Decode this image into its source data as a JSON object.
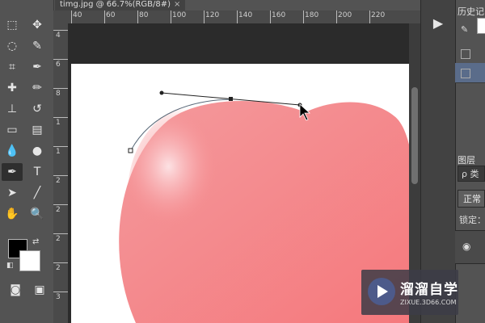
{
  "document_tab": {
    "title": "timg.jpg @ 66.7%(RGB/8#)",
    "close_symbol": "×"
  },
  "ruler": {
    "top_labels": [
      "40",
      "60",
      "80",
      "100",
      "120",
      "140",
      "160",
      "180",
      "200",
      "220"
    ],
    "left_labels": [
      "4",
      "6",
      "8",
      "1",
      "1",
      "2",
      "2",
      "2",
      "2",
      "3"
    ]
  },
  "tools": [
    {
      "name": "marquee-tool",
      "icon": "⬚"
    },
    {
      "name": "move-tool",
      "icon": "✥"
    },
    {
      "name": "lasso-tool",
      "icon": "◌"
    },
    {
      "name": "quick-select-tool",
      "icon": "✎"
    },
    {
      "name": "crop-tool",
      "icon": "⌗"
    },
    {
      "name": "eyedropper-tool",
      "icon": "✒"
    },
    {
      "name": "healing-brush-tool",
      "icon": "✚"
    },
    {
      "name": "brush-tool",
      "icon": "✏"
    },
    {
      "name": "clone-stamp-tool",
      "icon": "⊥"
    },
    {
      "name": "history-brush-tool",
      "icon": "↺"
    },
    {
      "name": "eraser-tool",
      "icon": "▭"
    },
    {
      "name": "gradient-tool",
      "icon": "▤"
    },
    {
      "name": "blur-tool",
      "icon": "💧"
    },
    {
      "name": "dodge-tool",
      "icon": "●"
    },
    {
      "name": "pen-tool",
      "icon": "✒"
    },
    {
      "name": "type-tool",
      "icon": "T"
    },
    {
      "name": "path-select-tool",
      "icon": "➤"
    },
    {
      "name": "line-tool",
      "icon": "╱"
    },
    {
      "name": "hand-tool",
      "icon": "✋"
    },
    {
      "name": "zoom-tool",
      "icon": "🔍"
    }
  ],
  "colors": {
    "foreground": "#000000",
    "background": "#ffffff",
    "heart_fill": "#f58a8c",
    "heart_highlight": "#fde2e4",
    "accent": "#5a6c8a"
  },
  "panels": {
    "history_tab": "历史记",
    "layers_tab": "图层",
    "search_placeholder": "ρ 类",
    "blend_mode": "正常",
    "lock_label": "锁定："
  },
  "watermark": {
    "title": "溜溜自学",
    "subtitle": "ZIXUE.3D66.COM"
  }
}
